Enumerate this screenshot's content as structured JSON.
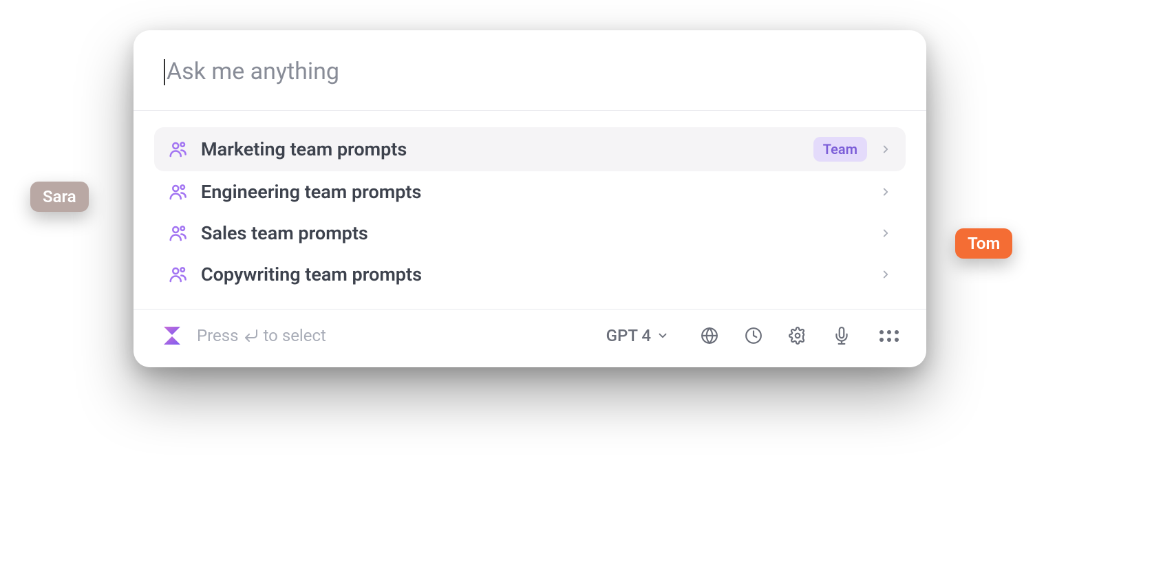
{
  "input": {
    "placeholder": "Ask me anything"
  },
  "items": [
    {
      "label": "Marketing team prompts",
      "badge": "Team",
      "selected": true
    },
    {
      "label": "Engineering team prompts",
      "badge": null,
      "selected": false
    },
    {
      "label": "Sales team prompts",
      "badge": null,
      "selected": false
    },
    {
      "label": "Copywriting team prompts",
      "badge": null,
      "selected": false
    }
  ],
  "footer": {
    "hint_prefix": "Press",
    "hint_suffix": "to select",
    "model": "GPT 4"
  },
  "cursors": {
    "sara": "Sara",
    "tom": "Tom"
  }
}
